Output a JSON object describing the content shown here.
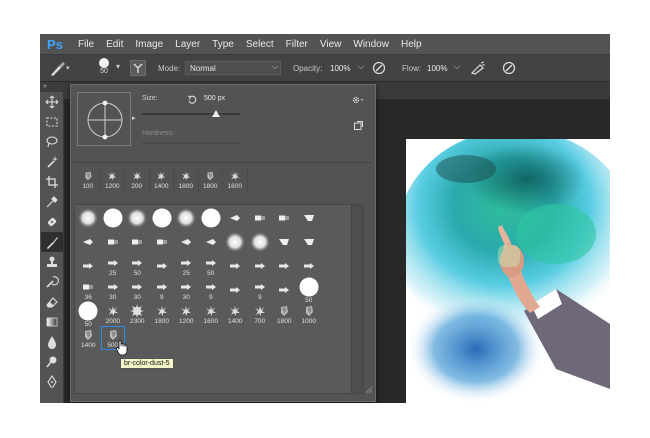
{
  "app": {
    "logo": "Ps"
  },
  "menu": [
    "File",
    "Edit",
    "Image",
    "Layer",
    "Type",
    "Select",
    "Filter",
    "View",
    "Window",
    "Help"
  ],
  "options": {
    "brush_size_value": "50",
    "mode_label": "Mode:",
    "mode_value": "Normal",
    "opacity_label": "Opacity:",
    "opacity_value": "100%",
    "flow_label": "Flow:",
    "flow_value": "100%"
  },
  "picker": {
    "size_label": "Size:",
    "size_value": "500 px",
    "size_level_pct": 76,
    "hardness_label": "Hardness:",
    "recent_brushes": [
      "100",
      "1200",
      "200",
      "1400",
      "1800",
      "1800",
      "1600"
    ],
    "tooltip": "br-color-dust-5",
    "grid": [
      {
        "kind": "soft",
        "label": ""
      },
      {
        "kind": "hard",
        "label": ""
      },
      {
        "kind": "soft",
        "label": ""
      },
      {
        "kind": "hard",
        "label": ""
      },
      {
        "kind": "soft",
        "label": ""
      },
      {
        "kind": "hard",
        "label": ""
      },
      {
        "kind": "tip",
        "label": ""
      },
      {
        "kind": "flat",
        "label": ""
      },
      {
        "kind": "flat",
        "label": ""
      },
      {
        "kind": "fan",
        "label": ""
      },
      {
        "kind": "tip",
        "label": ""
      },
      {
        "kind": "flat",
        "label": ""
      },
      {
        "kind": "flat",
        "label": ""
      },
      {
        "kind": "flat",
        "label": ""
      },
      {
        "kind": "tip",
        "label": ""
      },
      {
        "kind": "tip",
        "label": ""
      },
      {
        "kind": "soft",
        "label": ""
      },
      {
        "kind": "soft",
        "label": ""
      },
      {
        "kind": "fan",
        "label": ""
      },
      {
        "kind": "fan",
        "label": ""
      },
      {
        "kind": "arrow",
        "label": ""
      },
      {
        "kind": "arrow",
        "label": "25"
      },
      {
        "kind": "arrow",
        "label": "50"
      },
      {
        "kind": "arrow",
        "label": ""
      },
      {
        "kind": "arrow",
        "label": "25"
      },
      {
        "kind": "arrow",
        "label": "50"
      },
      {
        "kind": "arrow",
        "label": ""
      },
      {
        "kind": "arrow",
        "label": ""
      },
      {
        "kind": "arrow",
        "label": ""
      },
      {
        "kind": "arrow",
        "label": ""
      },
      {
        "kind": "flat",
        "label": "36"
      },
      {
        "kind": "arrow",
        "label": "30"
      },
      {
        "kind": "arrow",
        "label": "30"
      },
      {
        "kind": "arrow",
        "label": "9"
      },
      {
        "kind": "arrow",
        "label": "30"
      },
      {
        "kind": "arrow",
        "label": "9"
      },
      {
        "kind": "arrow",
        "label": ""
      },
      {
        "kind": "arrow",
        "label": "9"
      },
      {
        "kind": "arrow",
        "label": ""
      },
      {
        "kind": "hard",
        "label": "50"
      },
      {
        "kind": "hard",
        "label": "50"
      },
      {
        "kind": "dust",
        "label": "2000"
      },
      {
        "kind": "splat",
        "label": "2300"
      },
      {
        "kind": "dust",
        "label": "1800"
      },
      {
        "kind": "dust",
        "label": "1200"
      },
      {
        "kind": "dust",
        "label": "1600"
      },
      {
        "kind": "dust",
        "label": "1400"
      },
      {
        "kind": "dust",
        "label": "700"
      },
      {
        "kind": "shard",
        "label": "1800"
      },
      {
        "kind": "shard",
        "label": "1000"
      },
      {
        "kind": "shard",
        "label": "1400"
      },
      {
        "kind": "shard",
        "label": "500",
        "selected": true
      }
    ]
  },
  "colors": {
    "accent": "#2d8ceb",
    "ps_blue": "#3ea3ff",
    "panel": "#535353",
    "workspace": "#282828"
  }
}
